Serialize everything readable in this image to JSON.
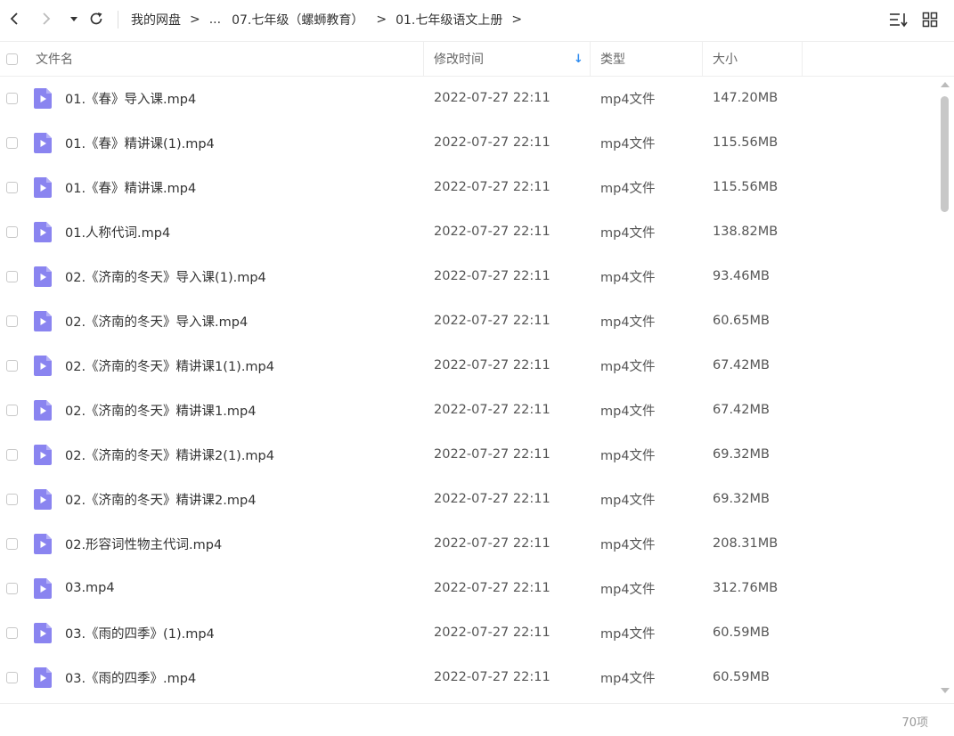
{
  "toolbar": {
    "icons": [
      "back-icon",
      "forward-icon",
      "history-dropdown-icon",
      "refresh-icon",
      "sort-icon",
      "grid-view-icon"
    ],
    "breadcrumb": [
      "我的网盘",
      "...",
      "07.七年级（螺蛳教育）",
      "01.七年级语文上册"
    ],
    "separator": ">"
  },
  "header": {
    "name": "文件名",
    "modified": "修改时间",
    "type": "类型",
    "size": "大小",
    "sort_indicator": "↓"
  },
  "files": [
    {
      "name": "01.《春》导入课.mp4",
      "modified": "2022-07-27 22:11",
      "type": "mp4文件",
      "size": "147.20MB"
    },
    {
      "name": "01.《春》精讲课(1).mp4",
      "modified": "2022-07-27 22:11",
      "type": "mp4文件",
      "size": "115.56MB"
    },
    {
      "name": "01.《春》精讲课.mp4",
      "modified": "2022-07-27 22:11",
      "type": "mp4文件",
      "size": "115.56MB"
    },
    {
      "name": "01.人称代词.mp4",
      "modified": "2022-07-27 22:11",
      "type": "mp4文件",
      "size": "138.82MB"
    },
    {
      "name": "02.《济南的冬天》导入课(1).mp4",
      "modified": "2022-07-27 22:11",
      "type": "mp4文件",
      "size": "93.46MB"
    },
    {
      "name": "02.《济南的冬天》导入课.mp4",
      "modified": "2022-07-27 22:11",
      "type": "mp4文件",
      "size": "60.65MB"
    },
    {
      "name": "02.《济南的冬天》精讲课1(1).mp4",
      "modified": "2022-07-27 22:11",
      "type": "mp4文件",
      "size": "67.42MB"
    },
    {
      "name": "02.《济南的冬天》精讲课1.mp4",
      "modified": "2022-07-27 22:11",
      "type": "mp4文件",
      "size": "67.42MB"
    },
    {
      "name": "02.《济南的冬天》精讲课2(1).mp4",
      "modified": "2022-07-27 22:11",
      "type": "mp4文件",
      "size": "69.32MB"
    },
    {
      "name": "02.《济南的冬天》精讲课2.mp4",
      "modified": "2022-07-27 22:11",
      "type": "mp4文件",
      "size": "69.32MB"
    },
    {
      "name": "02.形容词性物主代词.mp4",
      "modified": "2022-07-27 22:11",
      "type": "mp4文件",
      "size": "208.31MB"
    },
    {
      "name": "03.mp4",
      "modified": "2022-07-27 22:11",
      "type": "mp4文件",
      "size": "312.76MB"
    },
    {
      "name": "03.《雨的四季》(1).mp4",
      "modified": "2022-07-27 22:11",
      "type": "mp4文件",
      "size": "60.59MB"
    },
    {
      "name": "03.《雨的四季》.mp4",
      "modified": "2022-07-27 22:11",
      "type": "mp4文件",
      "size": "60.59MB"
    }
  ],
  "footer": {
    "count": "70项"
  },
  "colors": {
    "file_icon": "#8a84f0",
    "sort_arrow": "#2f8cf0",
    "border": "#eeeeee",
    "scroll_thumb": "#c8c8c8"
  }
}
